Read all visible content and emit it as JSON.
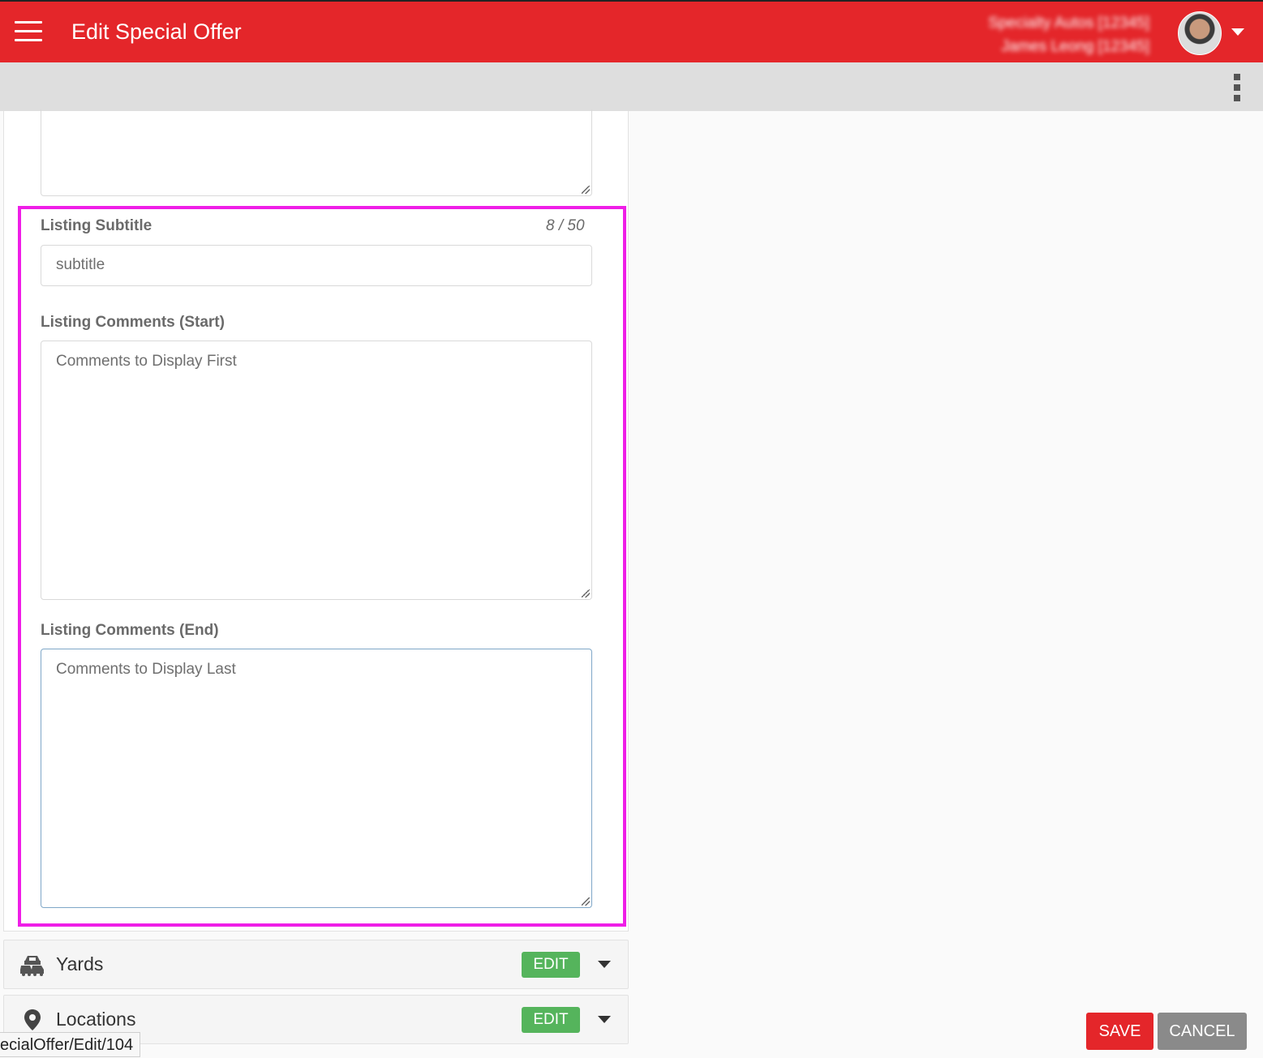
{
  "header": {
    "title": "Edit Special Offer",
    "user_line1": "Specialty Autos [12345]",
    "user_line2": "James Leong [12345]",
    "menu_icon": "hamburger-icon",
    "avatar_icon": "avatar",
    "dropdown_icon": "caret-down-icon"
  },
  "toolbar": {
    "more_icon": "vertical-dots-icon"
  },
  "form": {
    "subtitle_label": "Listing Subtitle",
    "subtitle_counter": "8 / 50",
    "subtitle_value": "subtitle",
    "comments_start_label": "Listing Comments (Start)",
    "comments_start_placeholder": "Comments to Display First",
    "comments_end_label": "Listing Comments (End)",
    "comments_end_placeholder": "Comments to Display Last"
  },
  "sections": [
    {
      "title": "Yards",
      "icon": "cars-icon",
      "edit_label": "EDIT"
    },
    {
      "title": "Locations",
      "icon": "map-pin-icon",
      "edit_label": "EDIT"
    }
  ],
  "actions": {
    "save_label": "SAVE",
    "cancel_label": "CANCEL"
  },
  "status_bar": {
    "url": "ecialOffer/Edit/104"
  },
  "colors": {
    "brand_red": "#e4262a",
    "edit_green": "#55b45c",
    "highlight_magenta": "#ef1ee7",
    "cancel_gray": "#8a8a8a"
  }
}
